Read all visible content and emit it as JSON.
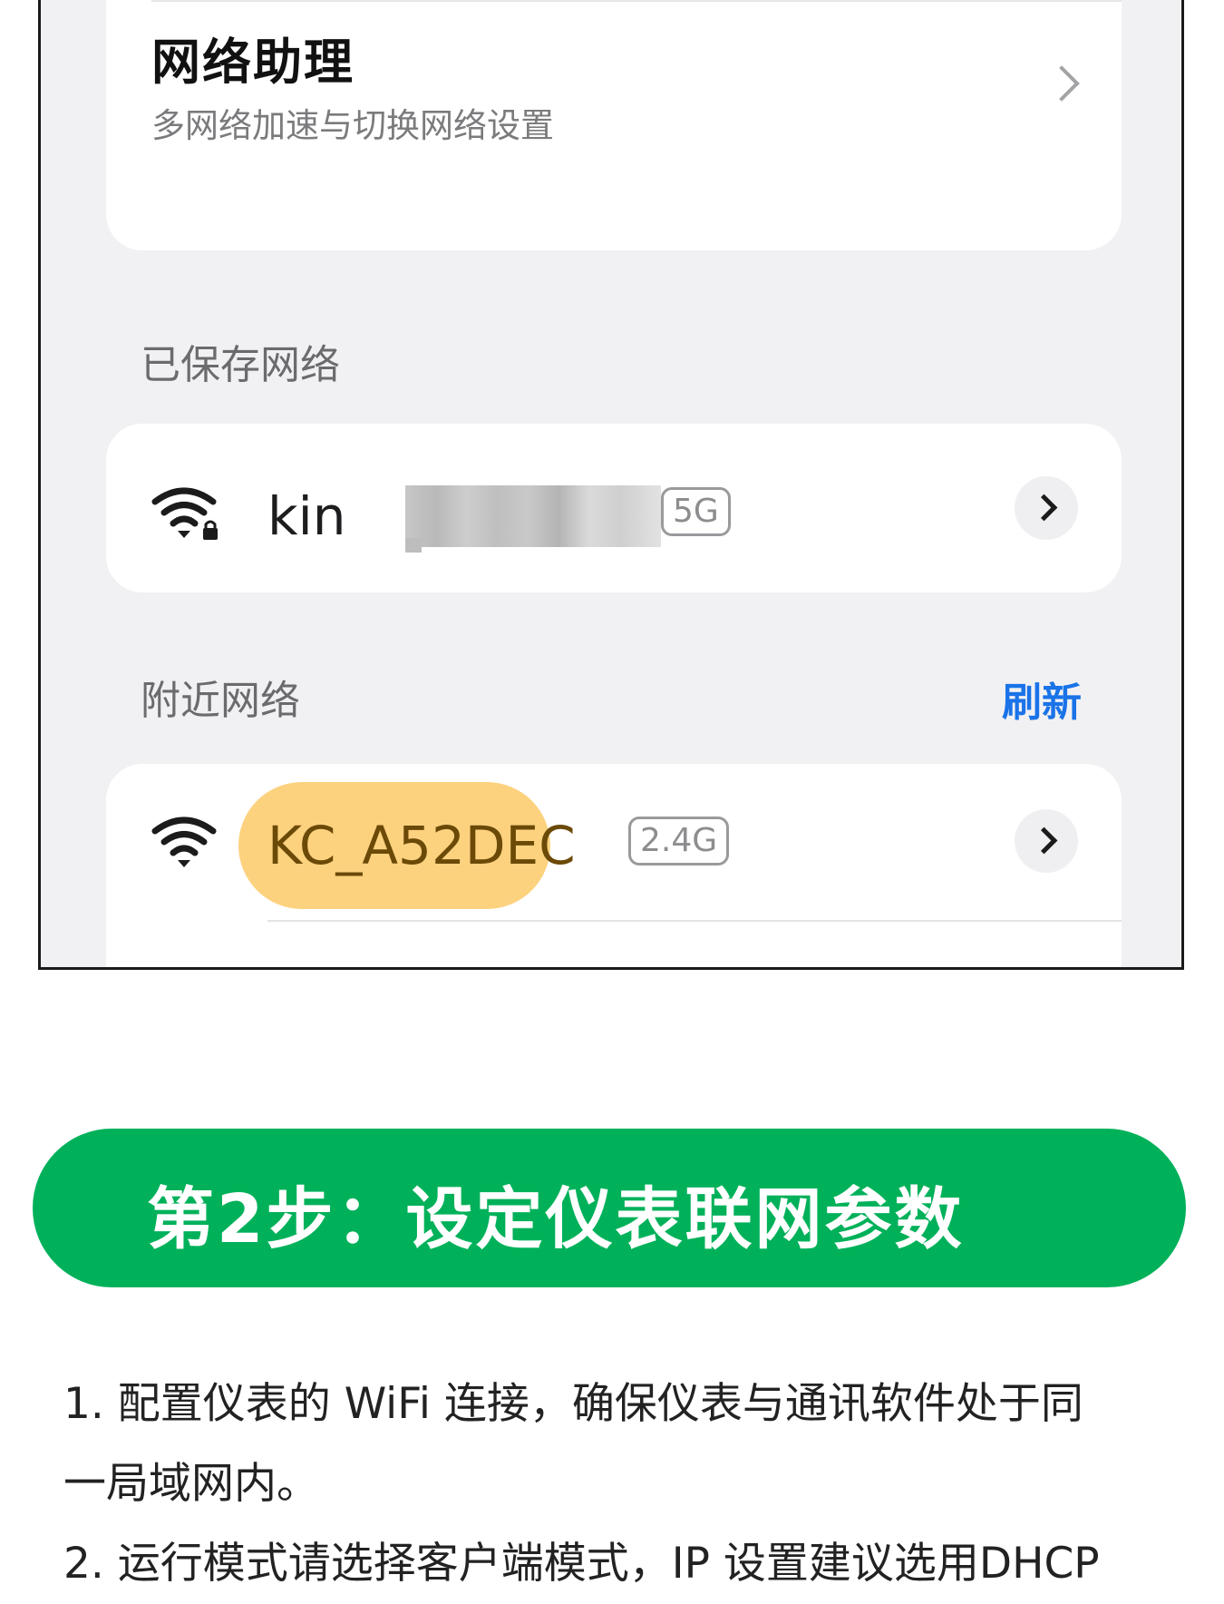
{
  "network_assistant": {
    "title": "网络助理",
    "subtitle": "多网络加速与切换网络设置"
  },
  "saved_section": {
    "label": "已保存网络",
    "networks": [
      {
        "ssid": "kin",
        "band": "5G",
        "icon": "wifi-locked-icon"
      }
    ]
  },
  "nearby_section": {
    "label": "附近网络",
    "refresh_label": "刷新",
    "refresh_color": "#1a73e8",
    "networks": [
      {
        "ssid": "KC_A52DEC",
        "band": "2.4G",
        "icon": "wifi-icon",
        "highlight_color": "#fdd27f"
      }
    ]
  },
  "step": {
    "title": "第2步：设定仪表联网参数",
    "color": "#00b15a"
  },
  "instructions": {
    "item1_line1": "1. 配置仪表的 WiFi 连接，确保仪表与通讯软件处于同",
    "item1_line2": "一局域网内。",
    "item2_partial": "2. 运行模式请选择客户端模式，IP 设置建议选用DHCP"
  }
}
